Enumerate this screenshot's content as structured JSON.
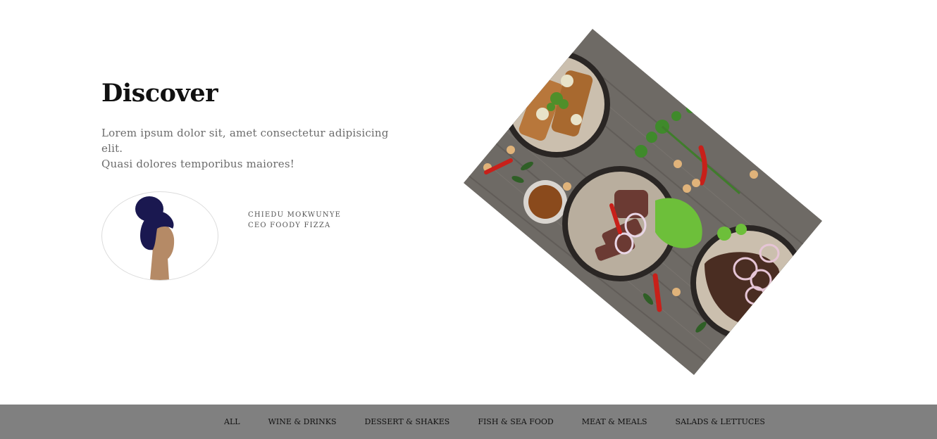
{
  "hero": {
    "title": "Discover",
    "text_line1": "Lorem ipsum dolor sit, amet consectetur adipisicing elit.",
    "text_line2": "Quasi dolores temporibus maiores!"
  },
  "author": {
    "name": "CHIEDU MOKWUNYE",
    "role": "CEO FOODY FIZZA"
  },
  "menu": {
    "items": [
      "ALL",
      "WINE & DRINKS",
      "DESSERT & SHAKES",
      "FISH & SEA FOOD",
      "MEAT & MEALS",
      "SALADS & LETTUCES"
    ]
  },
  "colors": {
    "menu_bar": "#808080",
    "hair": "#1a1850",
    "skin": "#b58a66",
    "wood": "#6e6a65"
  }
}
